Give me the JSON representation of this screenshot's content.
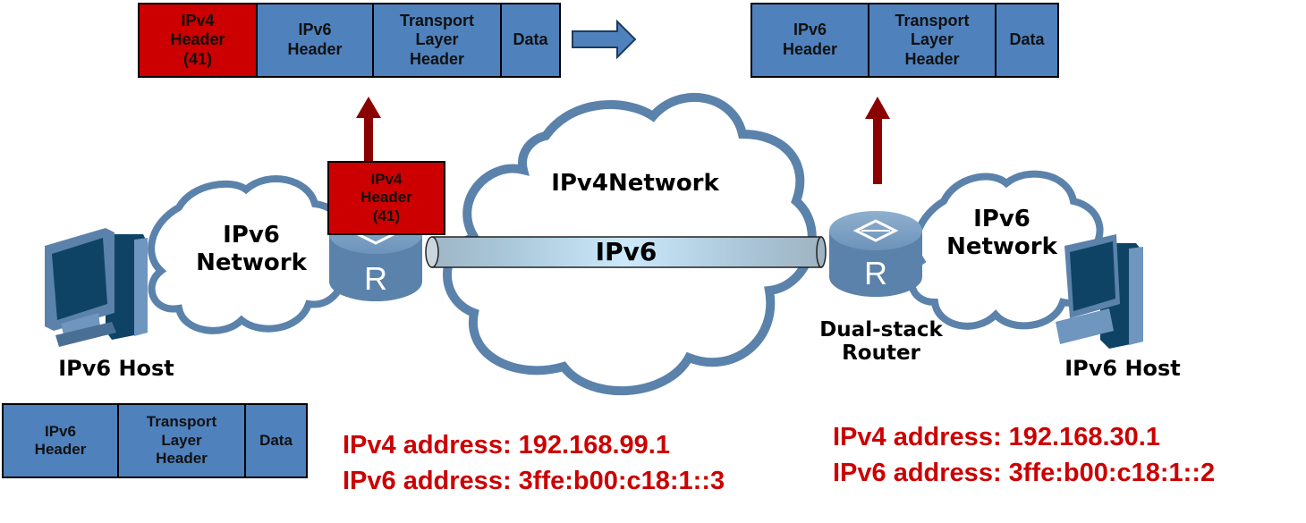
{
  "colors": {
    "header_blue": "#4f81bd",
    "ipv4_red": "#cc0000",
    "arrow_darkred": "#8b0000",
    "cloud_outline": "#5b82ab",
    "device_blue": "#5b82ab",
    "address_red": "#cc0000"
  },
  "top_left_packet": {
    "cells": [
      {
        "label": "IPv4\nHeader\n(41)",
        "color": "red"
      },
      {
        "label": "IPv6\nHeader",
        "color": "blue"
      },
      {
        "label": "Transport\nLayer\nHeader",
        "color": "blue"
      },
      {
        "label": "Data",
        "color": "blue"
      }
    ]
  },
  "top_right_packet": {
    "cells": [
      {
        "label": "IPv6\nHeader",
        "color": "blue"
      },
      {
        "label": "Transport\nLayer\nHeader",
        "color": "blue"
      },
      {
        "label": "Data",
        "color": "blue"
      }
    ]
  },
  "bottom_left_packet": {
    "cells": [
      {
        "label": "IPv6\nHeader",
        "color": "blue"
      },
      {
        "label": "Transport\nLayer\nHeader",
        "color": "blue"
      },
      {
        "label": "Data",
        "color": "blue"
      }
    ]
  },
  "encap_header": {
    "label": "IPv4\nHeader\n(41)"
  },
  "icons": {
    "process_arrow": "right-block-arrow",
    "up_arrow_left": "up-arrow",
    "up_arrow_right": "up-arrow",
    "left_host": "desktop-computer",
    "right_host": "desktop-computer",
    "left_router": "router",
    "right_router": "router"
  },
  "clouds": {
    "left": "IPv6\nNetwork",
    "center": "IPv4Network",
    "right": "IPv6\nNetwork"
  },
  "tunnel": {
    "label": "IPv6"
  },
  "routers": {
    "left_glyph": "R",
    "right_glyph": "R",
    "right_label": "Dual-stack\nRouter"
  },
  "hosts": {
    "left_label": "IPv6 Host",
    "right_label": "IPv6 Host"
  },
  "addresses": {
    "left": {
      "ipv4": "IPv4 address: 192.168.99.1",
      "ipv6": "IPv6 address: 3ffe:b00:c18:1::3"
    },
    "right": {
      "ipv4": "IPv4 address: 192.168.30.1",
      "ipv6": "IPv6 address: 3ffe:b00:c18:1::2"
    }
  }
}
